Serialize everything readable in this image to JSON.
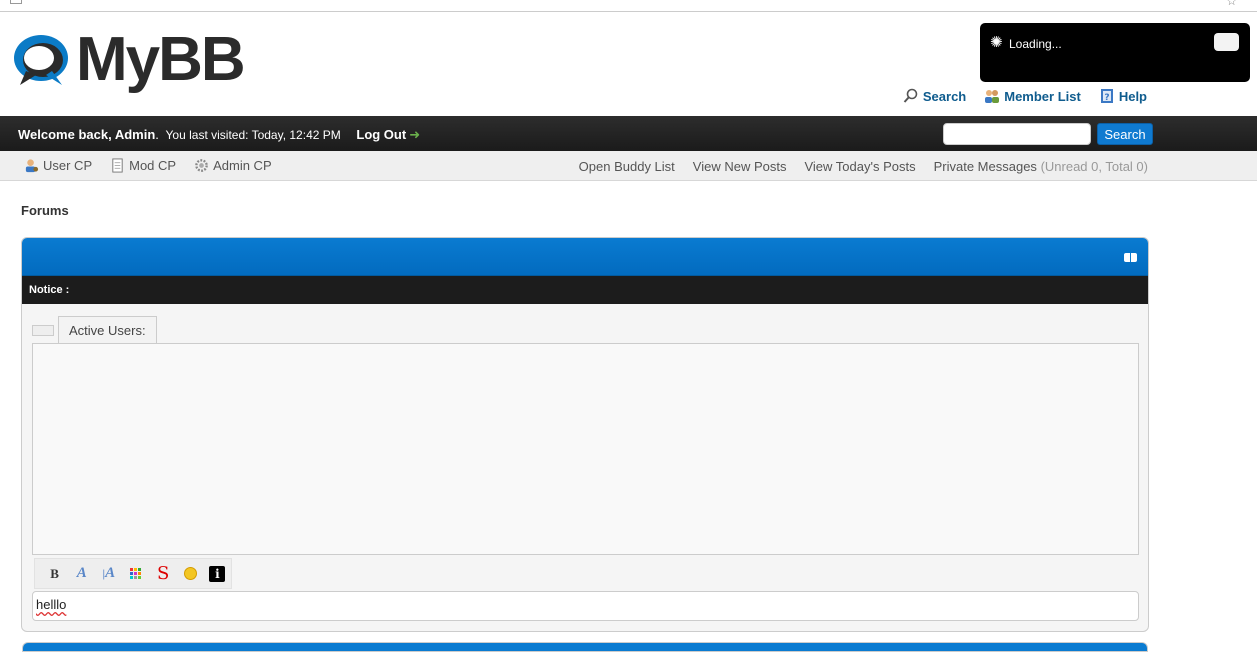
{
  "brand": {
    "logo_text": "MyBB"
  },
  "loading": {
    "text": "Loading..."
  },
  "top_links": [
    {
      "label": "Search",
      "icon": "magnifier-icon"
    },
    {
      "label": "Member List",
      "icon": "users-icon"
    },
    {
      "label": "Help",
      "icon": "help-book-icon"
    }
  ],
  "panel": {
    "welcome_prefix": "Welcome back, ",
    "username": "Admin",
    "welcome_suffix": ".",
    "last_visited": "You last visited: Today, 12:42 PM",
    "logout_label": "Log Out",
    "search_button": "Search",
    "search_value": ""
  },
  "user_nav": {
    "left": [
      {
        "label": "User CP",
        "icon": "user-cp-icon"
      },
      {
        "label": "Mod CP",
        "icon": "notepad-icon"
      },
      {
        "label": "Admin CP",
        "icon": "gear-icon"
      }
    ],
    "right": {
      "buddy": "Open Buddy List",
      "new_posts": "View New Posts",
      "todays_posts": "View Today's Posts",
      "pm_label": "Private Messages",
      "pm_count": "(Unread 0, Total 0)"
    }
  },
  "breadcrumb": "Forums",
  "shoutbox": {
    "notice_label": "Notice :",
    "tab_label": "Active Users:",
    "toolbar": [
      "B",
      "A",
      "A",
      "color",
      "S",
      "smiley",
      "i"
    ],
    "message_value": "helllo"
  },
  "colors": {
    "header_blue": "#0a7bd1",
    "dark_bar": "#1b1b1b",
    "link_blue": "#0f5c8e"
  }
}
